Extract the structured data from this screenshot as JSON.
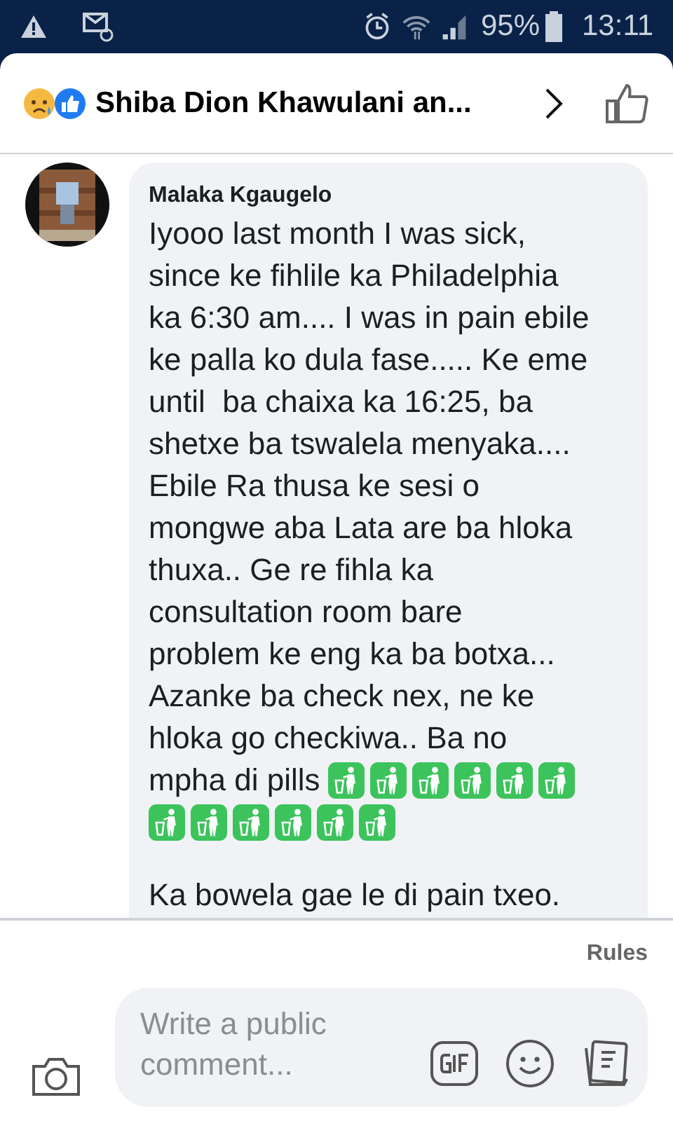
{
  "status_bar": {
    "battery": "95%",
    "time": "13:11"
  },
  "header": {
    "title": "Shiba Dion Khawulani an..."
  },
  "comment": {
    "author": "Malaka Kgaugelo",
    "lines": [
      "Iyooo last month I was sick,",
      "since ke fihlile ka Philadelphia",
      "ka 6:30 am.... I was in pain ebile",
      "ke palla ko dula fase..... Ke eme",
      "until  ba chaixa ka 16:25, ba",
      "shetxe ba tswalela menyaka....",
      "Ebile Ra thusa ke sesi o",
      "mongwe aba Lata are ba hloka",
      "thuxa.. Ge re fihla ka",
      "consultation room bare",
      "problem ke eng ka ba botxa...",
      "Azanke ba check nex, ne ke",
      "hloka go checkiwa.. Ba no",
      "mpha di pills"
    ],
    "emojis": [
      {
        "kind": "litter"
      },
      {
        "kind": "litter"
      },
      {
        "kind": "litter"
      },
      {
        "kind": "litter"
      },
      {
        "kind": "litter"
      },
      {
        "kind": "litter"
      },
      {
        "kind": "litter"
      },
      {
        "kind": "litter"
      },
      {
        "kind": "litter"
      },
      {
        "kind": "litter"
      },
      {
        "kind": "litter"
      },
      {
        "kind": "litter"
      }
    ],
    "text_2": "Ka bowela gae le di pain txeo."
  },
  "footer": {
    "rules": "Rules",
    "placeholder": "Write a public comment..."
  }
}
